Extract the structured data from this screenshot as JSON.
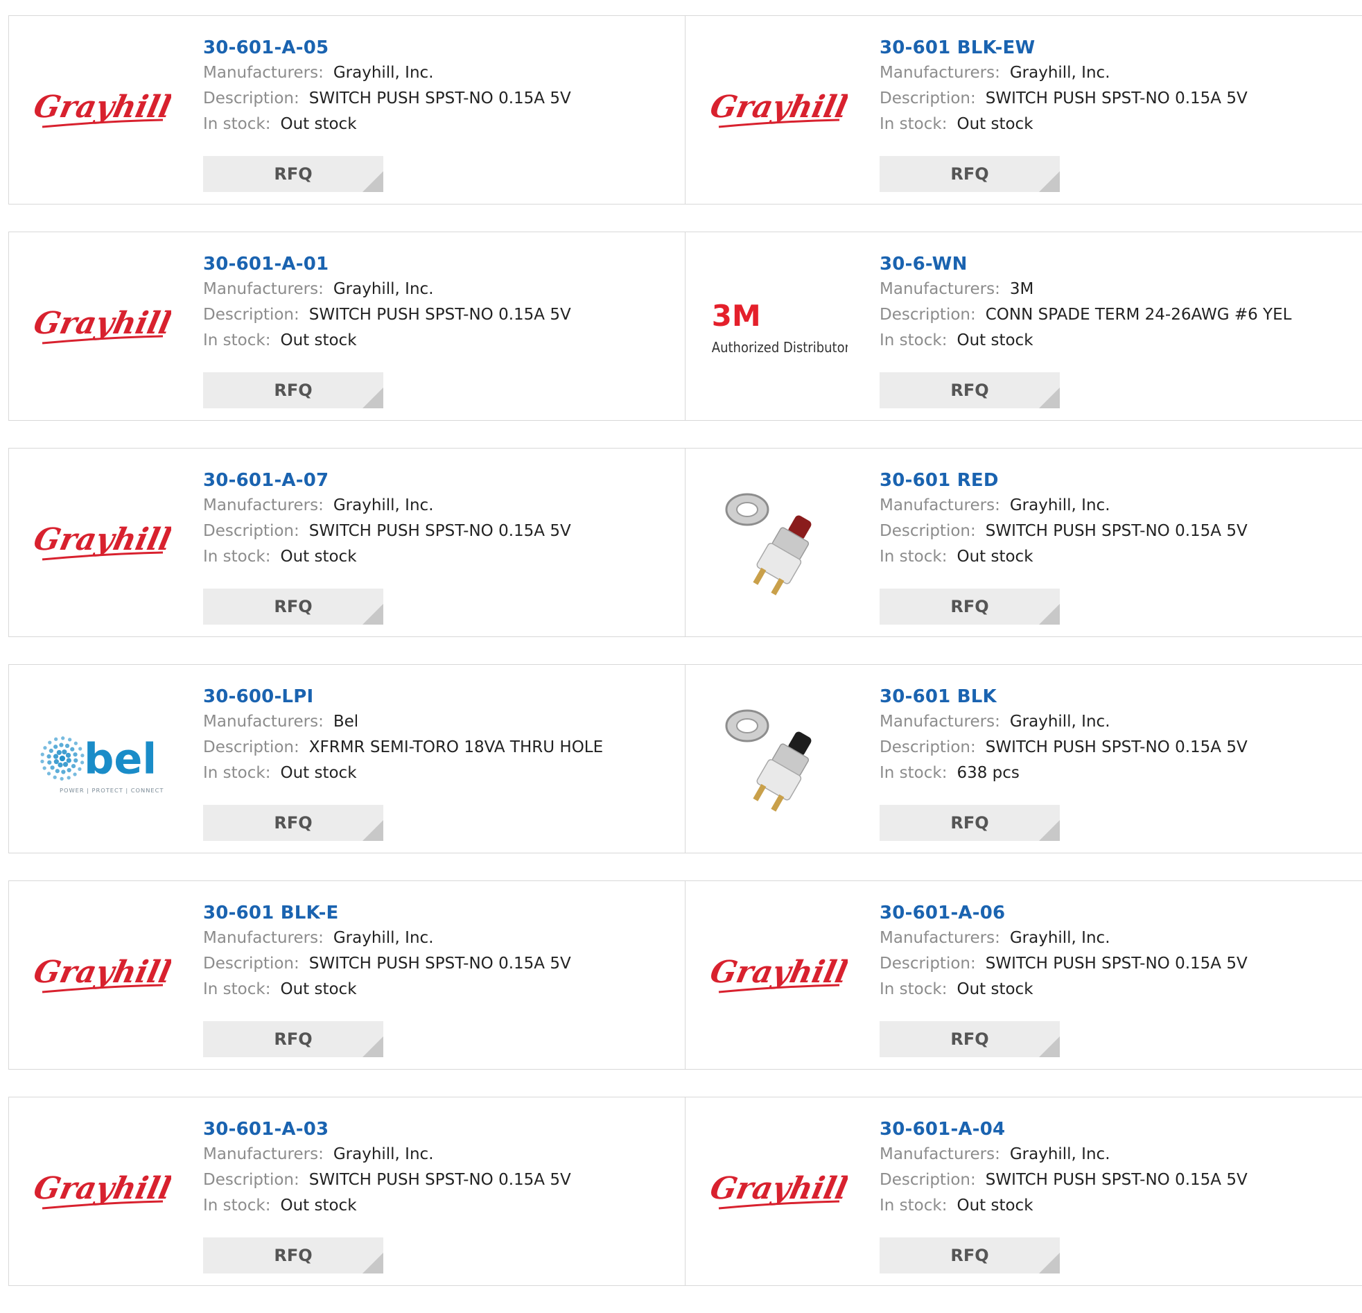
{
  "labels": {
    "manufacturers": "Manufacturers:",
    "description": "Description:",
    "in_stock": "In stock:",
    "rfq": "RFQ"
  },
  "colors": {
    "part_link": "#1a63b0",
    "label": "#8c8c8c",
    "grayhill_red": "#d8212e",
    "bel_blue": "#1a8cc8"
  },
  "products": [
    {
      "part": "30-601-A-05",
      "manufacturer": "Grayhill, Inc.",
      "description": "SWITCH PUSH SPST-NO 0.15A 5V",
      "stock": "Out stock",
      "logo": "grayhill-logo"
    },
    {
      "part": "30-601 BLK-EW",
      "manufacturer": "Grayhill, Inc.",
      "description": "SWITCH PUSH SPST-NO 0.15A 5V",
      "stock": "Out stock",
      "logo": "grayhill-logo"
    },
    {
      "part": "30-601-A-01",
      "manufacturer": "Grayhill, Inc.",
      "description": "SWITCH PUSH SPST-NO 0.15A 5V",
      "stock": "Out stock",
      "logo": "grayhill-logo"
    },
    {
      "part": "30-6-WN",
      "manufacturer": "3M",
      "description": "CONN SPADE TERM 24-26AWG #6 YEL",
      "stock": "Out stock",
      "logo": "3m-logo",
      "logo_text": "3M",
      "logo_subtext": "Authorized Distributor"
    },
    {
      "part": "30-601-A-07",
      "manufacturer": "Grayhill, Inc.",
      "description": "SWITCH PUSH SPST-NO 0.15A 5V",
      "stock": "Out stock",
      "logo": "grayhill-logo"
    },
    {
      "part": "30-601 RED",
      "manufacturer": "Grayhill, Inc.",
      "description": "SWITCH PUSH SPST-NO 0.15A 5V",
      "stock": "Out stock",
      "logo": "pushbutton-red-image"
    },
    {
      "part": "30-600-LPI",
      "manufacturer": "Bel",
      "description": "XFRMR SEMI-TORO 18VA THRU HOLE",
      "stock": "Out stock",
      "logo": "bel-logo",
      "logo_text": "bel",
      "logo_subtext": "POWER | PROTECT | CONNECT"
    },
    {
      "part": "30-601 BLK",
      "manufacturer": "Grayhill, Inc.",
      "description": "SWITCH PUSH SPST-NO 0.15A 5V",
      "stock": "638 pcs",
      "logo": "pushbutton-black-image"
    },
    {
      "part": "30-601 BLK-E",
      "manufacturer": "Grayhill, Inc.",
      "description": "SWITCH PUSH SPST-NO 0.15A 5V",
      "stock": "Out stock",
      "logo": "grayhill-logo"
    },
    {
      "part": "30-601-A-06",
      "manufacturer": "Grayhill, Inc.",
      "description": "SWITCH PUSH SPST-NO 0.15A 5V",
      "stock": "Out stock",
      "logo": "grayhill-logo"
    },
    {
      "part": "30-601-A-03",
      "manufacturer": "Grayhill, Inc.",
      "description": "SWITCH PUSH SPST-NO 0.15A 5V",
      "stock": "Out stock",
      "logo": "grayhill-logo"
    },
    {
      "part": "30-601-A-04",
      "manufacturer": "Grayhill, Inc.",
      "description": "SWITCH PUSH SPST-NO 0.15A 5V",
      "stock": "Out stock",
      "logo": "grayhill-logo"
    }
  ]
}
